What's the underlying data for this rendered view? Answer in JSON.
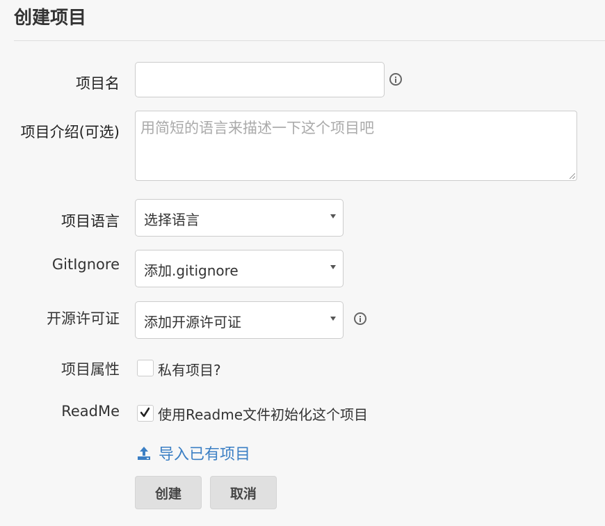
{
  "page": {
    "title": "创建项目"
  },
  "form": {
    "name": {
      "label": "项目名",
      "value": "",
      "placeholder": ""
    },
    "description": {
      "label": "项目介绍(可选)",
      "placeholder": "用简短的语言来描述一下这个项目吧",
      "value": ""
    },
    "language": {
      "label": "项目语言",
      "selected": "选择语言"
    },
    "gitignore": {
      "label": "GitIgnore",
      "selected": "添加.gitignore"
    },
    "license": {
      "label": "开源许可证",
      "selected": "添加开源许可证"
    },
    "private": {
      "label": "项目属性",
      "checkbox_label": "私有项目?",
      "checked": false
    },
    "readme": {
      "label": "ReadMe",
      "checkbox_label": "使用Readme文件初始化这个项目",
      "checked": true
    },
    "import_link": "导入已有项目"
  },
  "buttons": {
    "create": "创建",
    "cancel": "取消"
  },
  "colors": {
    "link": "#3b7fc4",
    "background": "#f7f7f7"
  },
  "icons": {
    "info": "info-circle-icon",
    "upload": "upload-icon",
    "check": "checkmark-icon"
  }
}
